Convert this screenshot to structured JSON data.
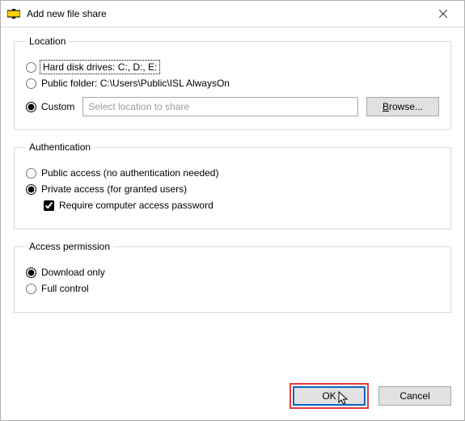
{
  "title": "Add new file share",
  "location": {
    "legend": "Location",
    "hard_disk_label": "Hard disk drives: C:, D:, E:",
    "public_folder_label": "Public folder: C:\\Users\\Public\\ISL AlwaysOn",
    "custom_label": "Custom",
    "custom_placeholder": "Select location to share",
    "custom_value": "",
    "browse_label": "Browse...",
    "selected": "custom"
  },
  "auth": {
    "legend": "Authentication",
    "public_label": "Public access (no authentication needed)",
    "private_label": "Private access (for granted users)",
    "require_pw_label": "Require computer access password",
    "selected": "private",
    "require_pw_checked": true
  },
  "perm": {
    "legend": "Access permission",
    "download_label": "Download only",
    "full_label": "Full control",
    "selected": "download"
  },
  "footer": {
    "ok_label": "OK",
    "cancel_label": "Cancel"
  }
}
